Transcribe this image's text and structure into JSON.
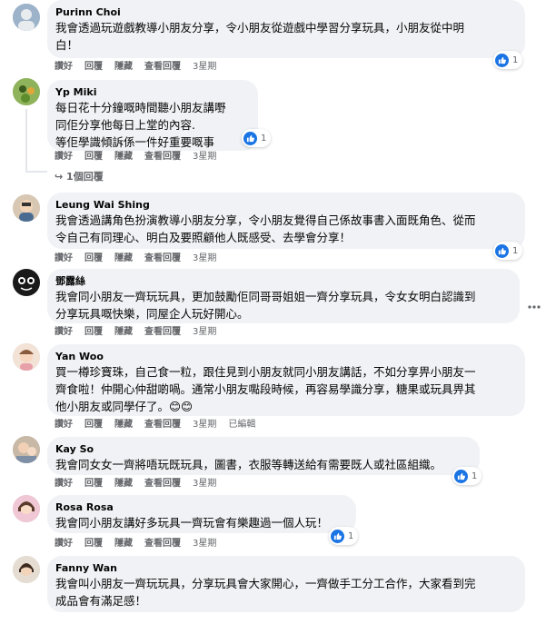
{
  "comments": [
    {
      "name": "Purinn Choi",
      "lines": [
        "我會透過玩遊戲教導小朋友分享，令小朋友從遊戲中學習分享玩具，小朋友從中明",
        "白！"
      ],
      "actions": {
        "like": "讚好",
        "reply": "回覆",
        "hide": "隱藏",
        "view": "查看回覆",
        "time": "3星期"
      },
      "reactions": "1"
    },
    {
      "name": "Yp Miki",
      "lines": [
        "每日花十分鐘嘅時間聽小朋友講嘢",
        "同佢分享他每日上堂的內容.",
        "等佢學識傾訴係一件好重要嘅事"
      ],
      "actions": {
        "like": "讚好",
        "reply": "回覆",
        "hide": "隱藏",
        "view": "查看回覆",
        "time": "3星期"
      },
      "reactions": "1",
      "replies_link": "1個回覆"
    },
    {
      "name": "Leung Wai Shing",
      "lines": [
        "我會透過講角色扮演教導小朋友分享，令小朋友覺得自己係故事書入面既角色、從而",
        "令自己有同理心、明白及要照顧他人既感受、去學會分享！"
      ],
      "actions": {
        "like": "讚好",
        "reply": "回覆",
        "hide": "隱藏",
        "view": "查看回覆",
        "time": "3星期"
      },
      "reactions": "1"
    },
    {
      "name": "鄧露絲",
      "lines": [
        "我會同小朋友一齊玩玩具，更加鼓勵佢同哥哥姐姐一齊分享玩具，令女女明白認識到",
        "分享玩具嘅快樂，同屋企人玩好開心。"
      ],
      "actions": {
        "like": "讚好",
        "reply": "回覆",
        "hide": "隱藏",
        "view": "查看回覆",
        "time": "3星期"
      }
    },
    {
      "name": "Yan Woo",
      "lines": [
        "買一樽珍寶珠，自己食一粒，跟住見到小朋友就同小朋友講話，不如分享畀小朋友一",
        "齊食啦！仲開心仲甜啲喎。通常小朋友嚸段時候，再容易學識分享，糖果或玩具畀其",
        "他小朋友或同學仔了。😊😊"
      ],
      "actions": {
        "like": "讚好",
        "reply": "回覆",
        "hide": "隱藏",
        "view": "查看回覆",
        "time": "3星期",
        "edited": "已編輯"
      }
    },
    {
      "name": "Kay So",
      "lines": [
        "我會同女女一齊將唔玩既玩具，圖書，衣服等轉送給有需要既人或社區組織。"
      ],
      "actions": {
        "like": "讚好",
        "reply": "回覆",
        "hide": "隱藏",
        "view": "查看回覆",
        "time": "3星期"
      },
      "reactions": "1"
    },
    {
      "name": "Rosa Rosa",
      "lines": [
        "我會同小朋友講好多玩具一齊玩會有樂趣過一個人玩！"
      ],
      "actions": {
        "like": "讚好",
        "reply": "回覆",
        "hide": "隱藏",
        "view": "查看回覆",
        "time": "3星期"
      },
      "reactions": "1"
    },
    {
      "name": "Fanny Wan",
      "lines": [
        "我會叫小朋友一齊玩玩具，分享玩具會大家開心，一齊做手工分工合作，大家看到完",
        "成品會有滿足感！"
      ],
      "actions": {}
    }
  ],
  "colors": {
    "bubble": "#f0f2f5",
    "like_blue": "#1b74e4",
    "meta_gray": "#65676b"
  }
}
